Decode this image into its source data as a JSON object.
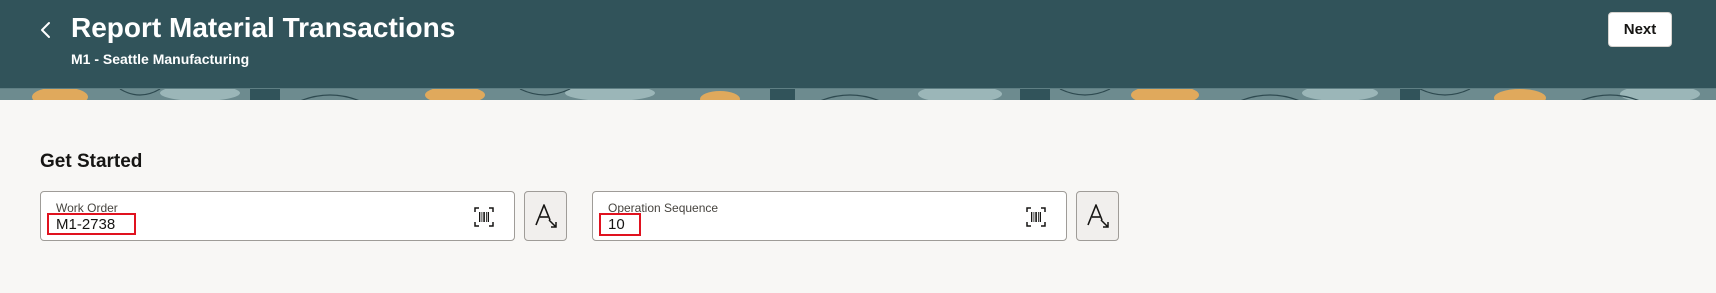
{
  "header": {
    "title": "Report Material Transactions",
    "subtitle": "M1 - Seattle Manufacturing",
    "back_icon": "chevron-left-icon",
    "next_label": "Next",
    "background_color": "#31535a"
  },
  "main": {
    "section_title": "Get Started",
    "fields": [
      {
        "label": "Work Order",
        "value": "M1-2738",
        "scan_icon": "barcode-scan-icon",
        "action_icon": "font-size-icon"
      },
      {
        "label": "Operation Sequence",
        "value": "10",
        "scan_icon": "barcode-scan-icon",
        "action_icon": "font-size-icon"
      }
    ]
  },
  "colors": {
    "highlight": "#e0121f",
    "page_background": "#f8f7f5"
  }
}
